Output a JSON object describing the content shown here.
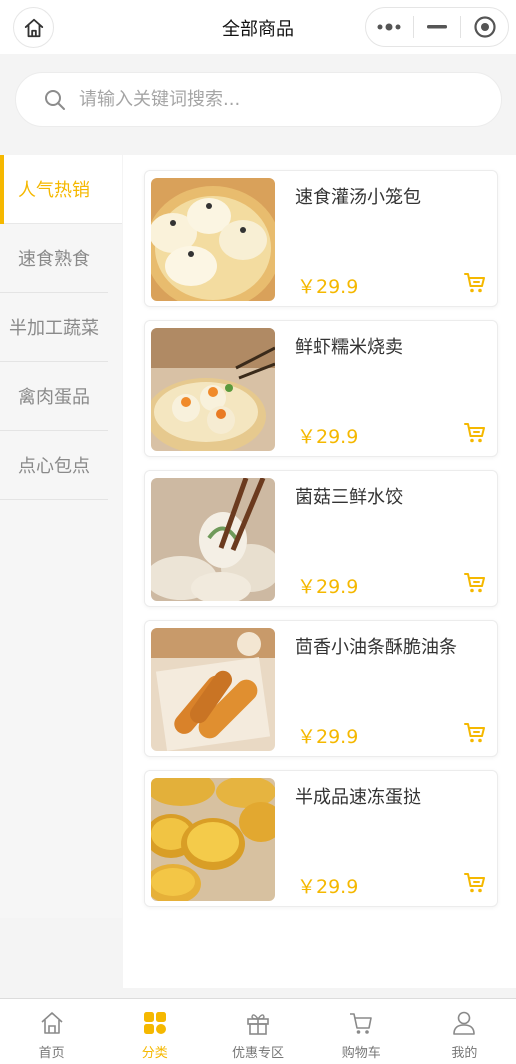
{
  "header": {
    "title": "全部商品"
  },
  "search": {
    "placeholder": "请输入关键词搜索..."
  },
  "categories": [
    {
      "label": "人气热销",
      "active": true
    },
    {
      "label": "速食熟食",
      "active": false
    },
    {
      "label": "半加工蔬菜",
      "active": false
    },
    {
      "label": "禽肉蛋品",
      "active": false
    },
    {
      "label": "点心包点",
      "active": false
    }
  ],
  "products": [
    {
      "name": "速食灌汤小笼包",
      "price": "￥29.9",
      "image": "xiaolongbao-photo"
    },
    {
      "name": "鲜虾糯米烧卖",
      "price": "￥29.9",
      "image": "shaomai-photo"
    },
    {
      "name": "菌菇三鲜水饺",
      "price": "￥29.9",
      "image": "dumpling-photo"
    },
    {
      "name": "茴香小油条酥脆油条",
      "price": "￥29.9",
      "image": "youtiao-photo"
    },
    {
      "name": "半成品速冻蛋挞",
      "price": "￥29.9",
      "image": "egg-tart-photo"
    }
  ],
  "tabbar": {
    "items": [
      {
        "label": "首页",
        "icon": "home-icon",
        "active": false
      },
      {
        "label": "分类",
        "icon": "category-grid-icon",
        "active": true
      },
      {
        "label": "优惠专区",
        "icon": "gift-icon",
        "active": false
      },
      {
        "label": "购物车",
        "icon": "cart-icon",
        "active": false
      },
      {
        "label": "我的",
        "icon": "user-icon",
        "active": false
      }
    ]
  },
  "colors": {
    "accent": "#f5b800",
    "background": "#f4f4f4",
    "text": "#333333",
    "muted": "#8a8a8a"
  }
}
